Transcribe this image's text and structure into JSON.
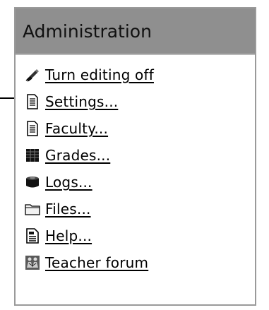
{
  "block": {
    "title": "Administration",
    "items": [
      {
        "label": "Turn editing off",
        "icon": "edit-pen-icon"
      },
      {
        "label": "Settings...",
        "icon": "document-icon"
      },
      {
        "label": "Faculty...",
        "icon": "document-icon"
      },
      {
        "label": "Grades...",
        "icon": "grades-grid-icon"
      },
      {
        "label": "Logs...",
        "icon": "logs-pot-icon"
      },
      {
        "label": "Files...",
        "icon": "folder-icon"
      },
      {
        "label": "Help...",
        "icon": "help-document-icon"
      },
      {
        "label": "Teacher forum",
        "icon": "forum-people-icon"
      }
    ]
  },
  "colors": {
    "header_bg": "#8f8f8f",
    "border": "#9a9a9a"
  }
}
